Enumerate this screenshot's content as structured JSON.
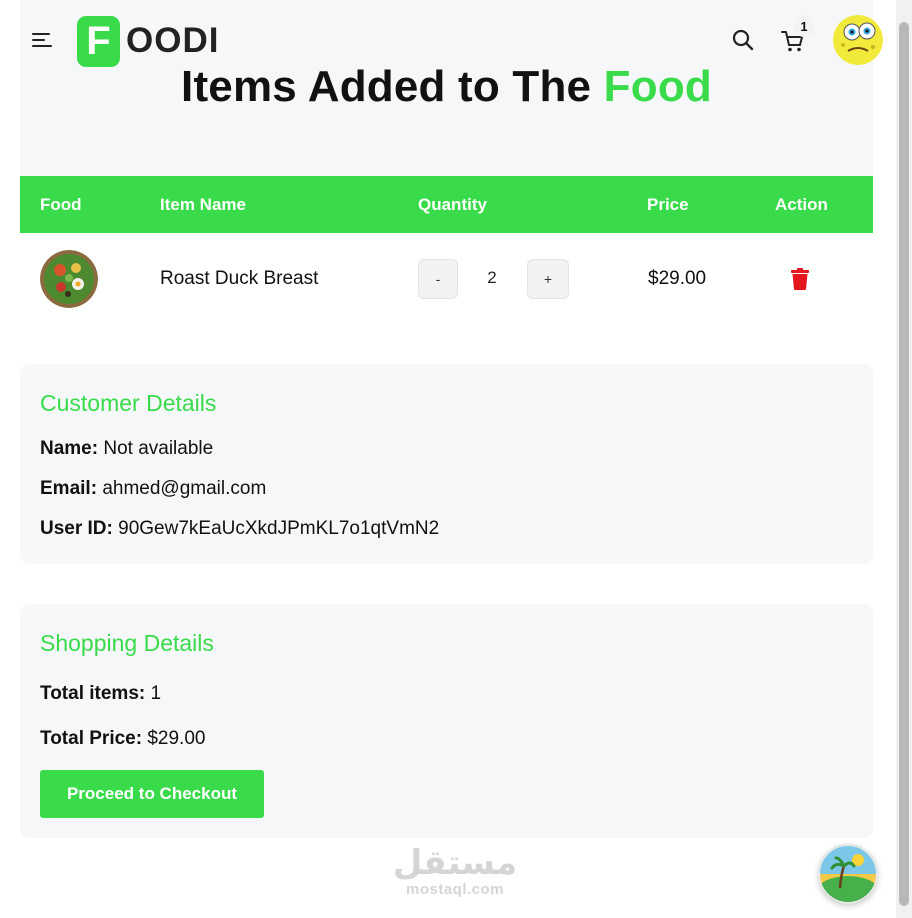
{
  "brand": {
    "logo_letter": "F",
    "logo_text": "OODI",
    "accent_color": "#39db4a"
  },
  "header": {
    "cart_count": "1"
  },
  "page": {
    "title_main": "Items Added to The",
    "title_accent": "Food"
  },
  "table": {
    "headers": {
      "food": "Food",
      "item_name": "Item Name",
      "quantity": "Quantity",
      "price": "Price",
      "action": "Action"
    },
    "rows": [
      {
        "name": "Roast Duck Breast",
        "quantity": "2",
        "price": "$29.00",
        "decrement": "-",
        "increment": "+"
      }
    ]
  },
  "customer": {
    "title": "Customer Details",
    "name_label": "Name:",
    "name_value": "Not available",
    "email_label": "Email:",
    "email_value": "ahmed@gmail.com",
    "userid_label": "User ID:",
    "userid_value": "90Gew7kEaUcXkdJPmKL7o1qtVmN2"
  },
  "shopping": {
    "title": "Shopping Details",
    "items_label": "Total items:",
    "items_value": "1",
    "price_label": "Total Price:",
    "price_value": "$29.00",
    "checkout_label": "Proceed to Checkout"
  },
  "watermark": {
    "arabic": "مستقل",
    "latin": "mostaql.com"
  },
  "icons": [
    "menu-icon",
    "search-icon",
    "cart-icon",
    "trash-icon"
  ]
}
